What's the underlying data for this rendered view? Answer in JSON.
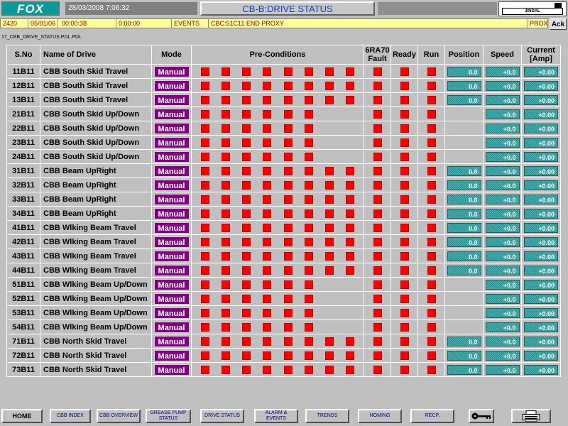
{
  "header": {
    "logo": "FOX",
    "datetime": "28/03/2008 7:06:32",
    "title": "CB-B:DRIVE STATUS",
    "company": "JINDAL"
  },
  "alarm": {
    "code": "2420",
    "date": "05/01/06",
    "time1": "00:00:38",
    "time2": "0:00:00",
    "type": "EVENTS",
    "message": "CBC:51C11 END  PROXY",
    "tail": "PROX",
    "ack_label": "Ack"
  },
  "filename": "17_CBB_DRIVE_STATUS.PDL.PDL",
  "table": {
    "headers": {
      "sno": "S.No",
      "name": "Name of Drive",
      "mode": "Mode",
      "pre": "Pre-Conditions",
      "fault": "6RA70 Fault",
      "ready": "Ready",
      "run": "Run",
      "position": "Position",
      "speed": "Speed",
      "current": "Current [Amp]"
    },
    "rows": [
      {
        "sno": "11B11",
        "name": "CBB South Skid Travel",
        "mode": "Manual",
        "pre": 8,
        "position": "0.0",
        "speed": "+0.0",
        "current": "+0.00"
      },
      {
        "sno": "12B11",
        "name": "CBB South Skid Travel",
        "mode": "Manual",
        "pre": 8,
        "position": "0.0",
        "speed": "+0.0",
        "current": "+0.00"
      },
      {
        "sno": "13B11",
        "name": "CBB South Skid Travel",
        "mode": "Manual",
        "pre": 8,
        "position": "0.0",
        "speed": "+0.0",
        "current": "+0.00"
      },
      {
        "sno": "21B11",
        "name": "CBB South Skid Up/Down",
        "mode": "Manual",
        "pre": 6,
        "position": "",
        "speed": "+0.0",
        "current": "+0.00"
      },
      {
        "sno": "22B11",
        "name": "CBB South Skid Up/Down",
        "mode": "Manual",
        "pre": 6,
        "position": "",
        "speed": "+0.0",
        "current": "+0.00"
      },
      {
        "sno": "23B11",
        "name": "CBB South Skid Up/Down",
        "mode": "Manual",
        "pre": 6,
        "position": "",
        "speed": "+0.0",
        "current": "+0.00"
      },
      {
        "sno": "24B11",
        "name": "CBB South Skid Up/Down",
        "mode": "Manual",
        "pre": 6,
        "position": "",
        "speed": "+0.0",
        "current": "+0.00"
      },
      {
        "sno": "31B11",
        "name": "CBB Beam UpRight",
        "mode": "Manual",
        "pre": 8,
        "position": "0.0",
        "speed": "+0.0",
        "current": "+0.00"
      },
      {
        "sno": "32B11",
        "name": "CBB Beam UpRight",
        "mode": "Manual",
        "pre": 8,
        "position": "0.0",
        "speed": "+0.0",
        "current": "+0.00"
      },
      {
        "sno": "33B11",
        "name": "CBB Beam UpRight",
        "mode": "Manual",
        "pre": 8,
        "position": "0.0",
        "speed": "+0.0",
        "current": "+0.00"
      },
      {
        "sno": "34B11",
        "name": "CBB Beam UpRight",
        "mode": "Manual",
        "pre": 8,
        "position": "0.0",
        "speed": "+0.0",
        "current": "+0.00"
      },
      {
        "sno": "41B11",
        "name": "CBB Wlking Beam Travel",
        "mode": "Manual",
        "pre": 8,
        "position": "0.0",
        "speed": "+0.0",
        "current": "+0.00"
      },
      {
        "sno": "42B11",
        "name": "CBB Wlking Beam Travel",
        "mode": "Manual",
        "pre": 8,
        "position": "0.0",
        "speed": "+0.0",
        "current": "+0.00"
      },
      {
        "sno": "43B11",
        "name": "CBB Wlking Beam Travel",
        "mode": "Manual",
        "pre": 8,
        "position": "0.0",
        "speed": "+0.0",
        "current": "+0.00"
      },
      {
        "sno": "44B11",
        "name": "CBB Wlking Beam Travel",
        "mode": "Manual",
        "pre": 8,
        "position": "0.0",
        "speed": "+0.0",
        "current": "+0.00"
      },
      {
        "sno": "51B11",
        "name": "CBB Wlking Beam Up/Down",
        "mode": "Manual",
        "pre": 6,
        "position": "",
        "speed": "+0.0",
        "current": "+0.00"
      },
      {
        "sno": "52B11",
        "name": "CBB Wlking Beam Up/Down",
        "mode": "Manual",
        "pre": 6,
        "position": "",
        "speed": "+0.0",
        "current": "+0.00"
      },
      {
        "sno": "53B11",
        "name": "CBB Wlking Beam Up/Down",
        "mode": "Manual",
        "pre": 6,
        "position": "",
        "speed": "+0.0",
        "current": "+0.00"
      },
      {
        "sno": "54B11",
        "name": "CBB Wlking Beam Up/Down",
        "mode": "Manual",
        "pre": 6,
        "position": "",
        "speed": "+0.0",
        "current": "+0.00"
      },
      {
        "sno": "71B11",
        "name": "CBB North Skid Travel",
        "mode": "Manual",
        "pre": 8,
        "position": "0.0",
        "speed": "+0.0",
        "current": "+0.00"
      },
      {
        "sno": "72B11",
        "name": "CBB North Skid Travel",
        "mode": "Manual",
        "pre": 8,
        "position": "0.0",
        "speed": "+0.0",
        "current": "+0.00"
      },
      {
        "sno": "73B11",
        "name": "CBB North Skid Travel",
        "mode": "Manual",
        "pre": 8,
        "position": "0.0",
        "speed": "+0.0",
        "current": "+0.00"
      }
    ]
  },
  "footer": {
    "buttons": [
      "HOME",
      "CBB INDEX",
      "CBB OVERVIEW",
      "GREASE PUMP STATUS",
      "DRIVE STATUS",
      "ALARM & EVENTS",
      "TRENDS",
      "HOMING",
      "RECP."
    ],
    "icons": [
      "key-icon",
      "printer-icon"
    ]
  },
  "colors": {
    "logo_bg": "#0a9a9a",
    "title_text": "#1a3ab4",
    "alarm_bg": "#ffff99",
    "alarm_text": "#a00000",
    "mode_bg": "#800080",
    "indicator_red": "#ff0000",
    "value_teal": "#2a8c8c",
    "background": "#c0c0c0"
  }
}
